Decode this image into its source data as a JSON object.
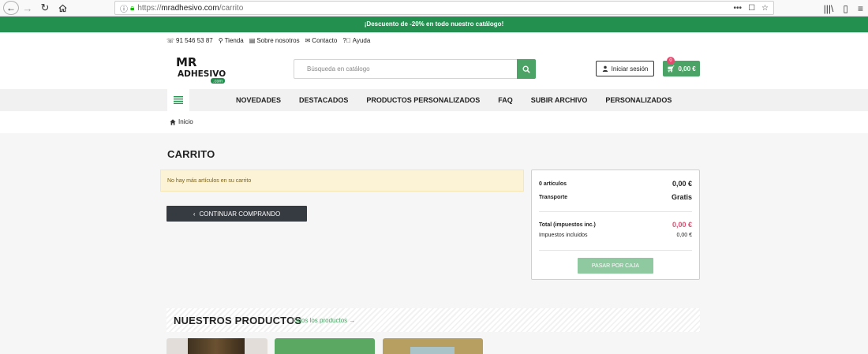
{
  "browser": {
    "url_prefix": "https://",
    "url_host": "mradhesivo.com",
    "url_path": "/carrito",
    "more_label": "•••"
  },
  "promo": {
    "text": "¡Descuento de -20% en todo nuestro catálogo!"
  },
  "contact": {
    "phone": "91 546 53 87",
    "store": "Tienda",
    "about": "Sobre nosotros",
    "contact": "Contacto",
    "help": "Ayuda"
  },
  "logo": {
    "line1": "MR",
    "line2": "ADHESIVO",
    "small": ".com"
  },
  "search": {
    "placeholder": "Búsqueda en catálogo"
  },
  "account": {
    "login_label": "Iniciar sesión"
  },
  "cart_button": {
    "count": "0",
    "total": "0,00 €"
  },
  "nav": {
    "items": [
      "NOVEDADES",
      "DESTACADOS",
      "PRODUCTOS PERSONALIZADOS",
      "FAQ",
      "SUBIR ARCHIVO",
      "PERSONALIZADOS"
    ]
  },
  "breadcrumb": {
    "home": "Inicio"
  },
  "cart": {
    "title": "CARRITO",
    "empty_message": "No hay más artículos en su carrito",
    "continue_label": "CONTINUAR COMPRANDO"
  },
  "summary": {
    "items_label": "0 artículos",
    "items_value": "0,00 €",
    "shipping_label": "Transporte",
    "shipping_value": "Gratis",
    "total_label": "Total (impuestos inc.)",
    "total_value": "0,00 €",
    "taxes_label": "Impuestos incluidos",
    "taxes_value": "0,00 €",
    "checkout_label": "PASAR POR CAJA"
  },
  "products": {
    "title": "NUESTROS PRODUCTOS",
    "all_link": "Todos los productos →"
  },
  "colors": {
    "brand_green": "#23904f",
    "button_green": "#4ba365",
    "total_red": "#e24b6f",
    "dark_button": "#363a41"
  }
}
